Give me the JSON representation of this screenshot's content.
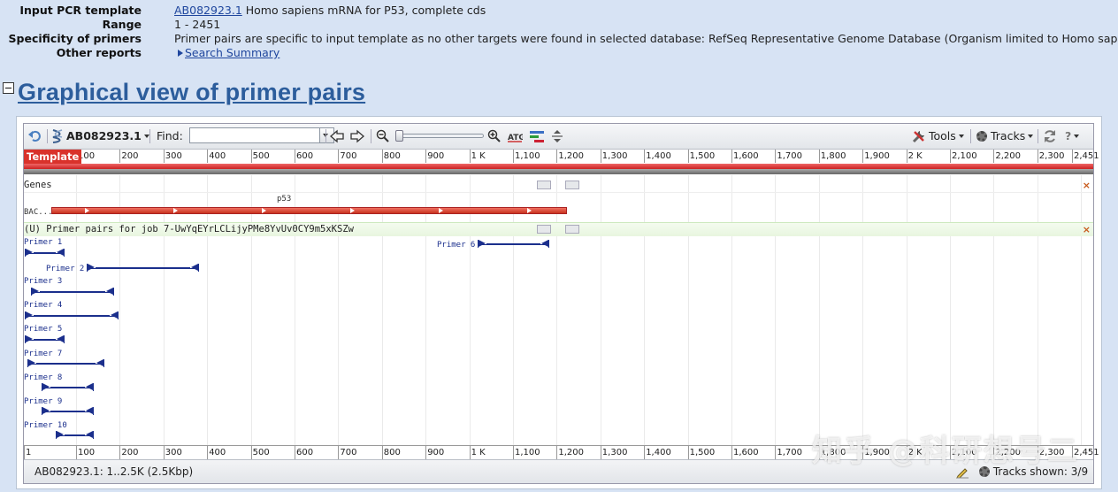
{
  "info": {
    "rows": [
      {
        "key": "Input PCR template",
        "link": "AB082923.1",
        "value": " Homo sapiens mRNA for P53, complete cds"
      },
      {
        "key": "Range",
        "link": "",
        "value": "1 - 2451"
      },
      {
        "key": "Specificity of primers",
        "link": "",
        "value": "Primer pairs are specific to input template as no other targets were found in selected database: RefSeq Representative Genome Database (Organism limited to Homo sapiens)"
      },
      {
        "key": "Other reports",
        "link": "Search Summary",
        "value": ""
      }
    ]
  },
  "section": {
    "title": "Graphical view of primer pairs"
  },
  "toolbar": {
    "seq_label": "AB082923.1",
    "find_label": "Find:",
    "find_value": "",
    "tools_label": "Tools",
    "tracks_label": "Tracks"
  },
  "ruler": {
    "template_label": "Template",
    "ticks_top": [
      "100",
      "200",
      "300",
      "400",
      "500",
      "600",
      "700",
      "800",
      "900",
      "1 K",
      "1,100",
      "1,200",
      "1,300",
      "1,400",
      "1,500",
      "1,600",
      "1,700",
      "1,800",
      "1,900",
      "2 K",
      "2,100",
      "2,200",
      "2,300",
      "2,451"
    ],
    "ticks_bottom": [
      "1",
      "100",
      "200",
      "300",
      "400",
      "500",
      "600",
      "700",
      "800",
      "900",
      "1 K",
      "1,100",
      "1,200",
      "1,300",
      "1,400",
      "1,500",
      "1,600",
      "1,700",
      "1,800",
      "1,900",
      "2 K",
      "2,100",
      "2,200",
      "2,300",
      "2,451"
    ]
  },
  "genes_track": {
    "header": "Genes",
    "row_label": "BAC...",
    "gene_name": "p53"
  },
  "primers_track": {
    "header": "(U) Primer pairs for job 7-UwYqEYrLCLijyPMe8YvUv0CY9m5xKSZw",
    "primers": [
      {
        "label": "Primer 1"
      },
      {
        "label": "Primer 2"
      },
      {
        "label": "Primer 3"
      },
      {
        "label": "Primer 4"
      },
      {
        "label": "Primer 5"
      },
      {
        "label": "Primer 6"
      },
      {
        "label": "Primer 7"
      },
      {
        "label": "Primer 8"
      },
      {
        "label": "Primer 9"
      },
      {
        "label": "Primer 10"
      }
    ]
  },
  "status": {
    "left": "AB082923.1: 1..2.5K (2.5Kbp)",
    "right": "Tracks shown: 3/9"
  },
  "watermark": "知乎 @科研想号二"
}
